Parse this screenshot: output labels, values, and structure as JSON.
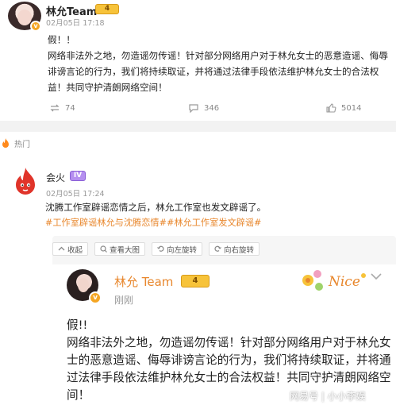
{
  "post1": {
    "author": "林允Team",
    "level": "4",
    "time": "02月05日 17:18",
    "text": "假！！\n网络非法外之地，勿造谣勿传谣！针对部分网络用户对于林允女士的恶意造谣、侮辱诽谤言论的行为，我们将持续取证，并将通过法律手段依法维护林允女士的合法权益！共同守护清朗网络空间！",
    "reposts": "74",
    "comments": "346",
    "likes": "5014"
  },
  "post2": {
    "hot_label": "热门",
    "author": "会火",
    "level": "IV",
    "time": "02月05日 17:24",
    "text": "沈腾工作室辟谣恋情之后，林允工作室也发文辟谣了。",
    "tags": "#工作室辟谣林允与沈腾恋情##林允工作室发文辟谣#"
  },
  "toolbar": {
    "collapse": "收起",
    "view_large": "查看大图",
    "rotate_left": "向左旋转",
    "rotate_right": "向右旋转"
  },
  "inner_post": {
    "author": "林允 Team",
    "level": "4",
    "time": "刚刚",
    "text": "假!!\n网络非法外之地，勿造谣勿传谣！针对部分网络用户对于林允女士的恶意造谣、侮辱诽谤言论的行为，我们将持续取证，并将通过法律手段依法维护林允女士的合法权益！共同守护清朗网络空间！",
    "sticker_text": "Nice"
  },
  "watermark": "网易号 | 小小李娱",
  "colors": {
    "orange": "#e8872d",
    "gray_text": "#999999",
    "gold": "#f7c33a"
  },
  "icons": [
    "verified-badge-icon",
    "level-badge-icon",
    "repost-icon",
    "comment-icon",
    "like-icon",
    "hot-flame-icon",
    "chevron-down-icon",
    "collapse-icon",
    "view-large-icon",
    "rotate-left-icon",
    "rotate-right-icon"
  ]
}
